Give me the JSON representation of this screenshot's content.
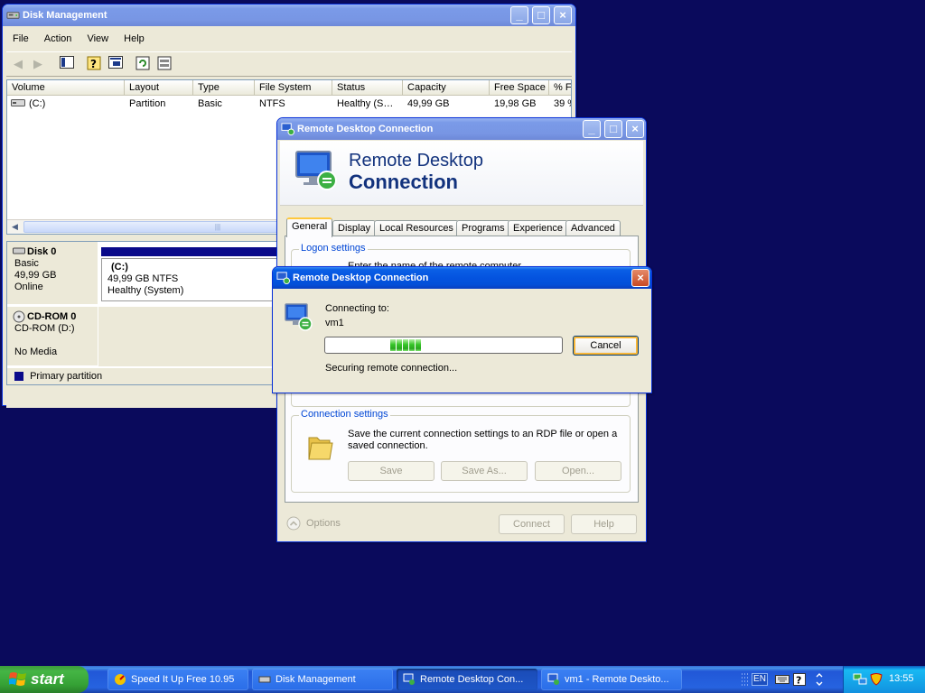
{
  "disk_management": {
    "title": "Disk Management",
    "menu": [
      "File",
      "Action",
      "View",
      "Help"
    ],
    "columns": [
      "Volume",
      "Layout",
      "Type",
      "File System",
      "Status",
      "Capacity",
      "Free Space",
      "% Fr"
    ],
    "rows": [
      [
        "(C:)",
        "Partition",
        "Basic",
        "NTFS",
        "Healthy (S…",
        "49,99 GB",
        "19,98 GB",
        "39 %"
      ]
    ],
    "disks": [
      {
        "name": "Disk 0",
        "line1": "Basic",
        "line2": "49,99 GB",
        "line3": "Online",
        "partition_name": "(C:)",
        "partition_size": "49,99 GB NTFS",
        "partition_status": "Healthy (System)"
      },
      {
        "name": "CD-ROM 0",
        "line1": "CD-ROM (D:)",
        "line2": "",
        "line3": "No Media"
      }
    ],
    "legend": "Primary partition"
  },
  "rdc_window": {
    "title": "Remote Desktop Connection",
    "banner_line1": "Remote Desktop",
    "banner_line2": "Connection",
    "tabs": [
      "General",
      "Display",
      "Local Resources",
      "Programs",
      "Experience",
      "Advanced"
    ],
    "logon_group": "Logon settings",
    "logon_text": "Enter the name of the remote computer.",
    "connection_group": "Connection settings",
    "connection_text": "Save the current connection settings to an RDP file or open a saved connection.",
    "save": "Save",
    "save_as": "Save As...",
    "open": "Open...",
    "options": "Options",
    "connect": "Connect",
    "help": "Help"
  },
  "connecting_dialog": {
    "title": "Remote Desktop Connection",
    "connecting_label": "Connecting to:",
    "host": "vm1",
    "status": "Securing remote connection...",
    "cancel": "Cancel",
    "progress_segments": 5
  },
  "taskbar": {
    "start": "start",
    "items": [
      "Speed It Up Free 10.95",
      "Disk Management",
      "Remote Desktop Con...",
      "vm1 - Remote Deskto..."
    ],
    "active_index": 2,
    "lang": "EN",
    "clock": "13:55"
  }
}
